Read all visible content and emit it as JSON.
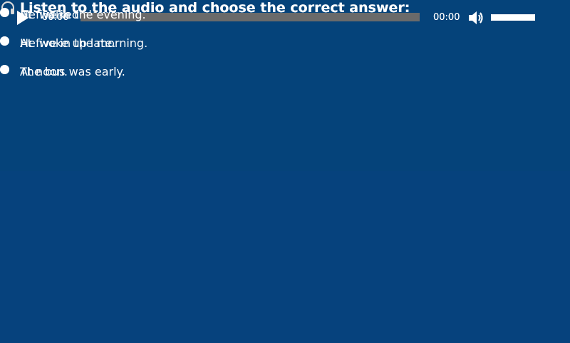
{
  "questions": [
    {
      "prompt": "Listen to the audio and choose the correct answer:",
      "icon": "headphones-icon",
      "player": {
        "current_time": "00:00",
        "duration": "00:00",
        "progress": 0,
        "volume": 1.0
      },
      "options": [
        "He walked slowly.",
        "He woke up late.",
        "The bus was early."
      ]
    },
    {
      "prompt": "Listen to the audio and choose the correct answer:",
      "icon": "headphones-icon",
      "player": {
        "current_time": "00:00",
        "duration": "00:00",
        "progress": 0,
        "volume": 1.0
      },
      "options": [
        "At five in the evening.",
        "At five in the morning.",
        "At noon."
      ]
    }
  ],
  "colors": {
    "background": "#05437a",
    "player_background": "#222222",
    "track": "#6a6a6a",
    "text": "#ffffff"
  }
}
